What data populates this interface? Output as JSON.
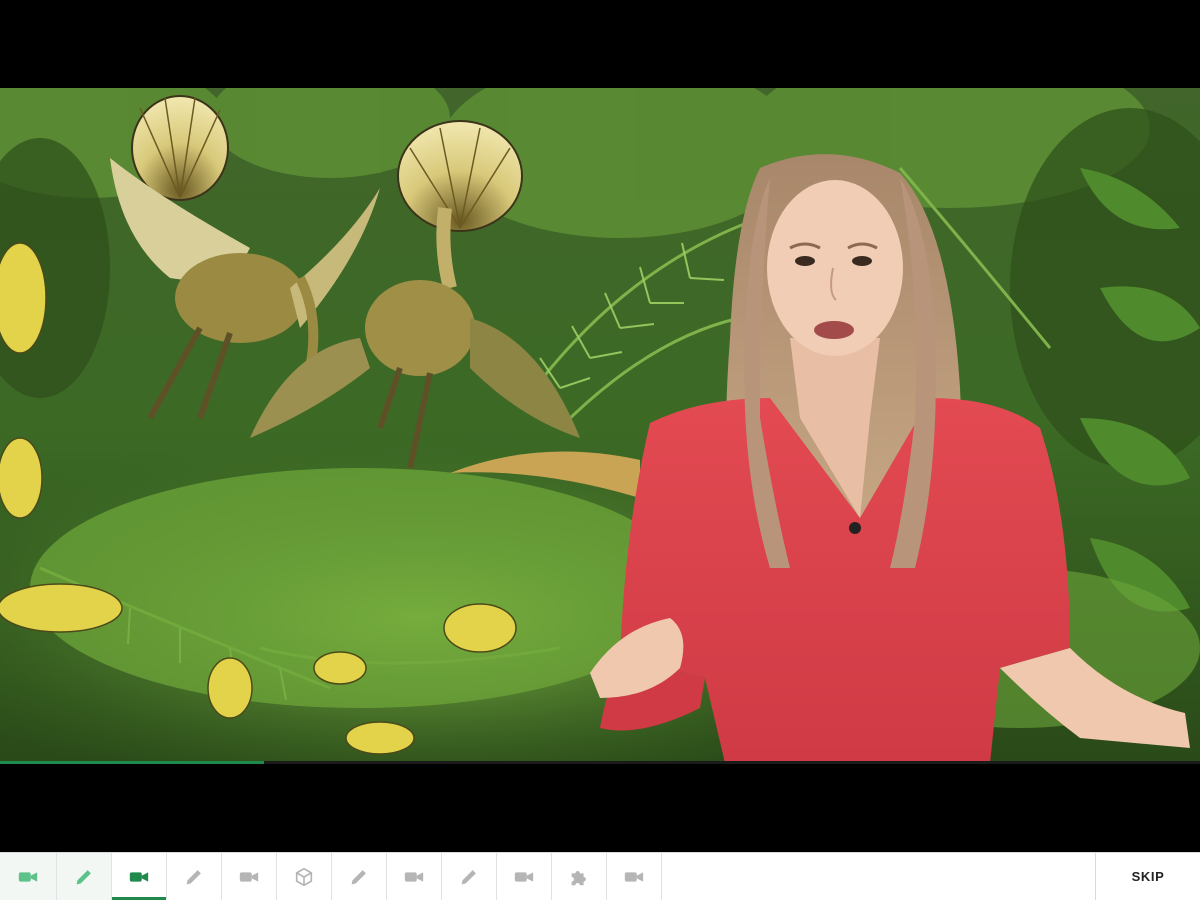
{
  "player": {
    "video_progress_fraction": 0.22
  },
  "lesson_steps": [
    {
      "type": "video",
      "icon": "video-camera-icon",
      "state": "completed"
    },
    {
      "type": "exercise",
      "icon": "pencil-icon",
      "state": "completed"
    },
    {
      "type": "video",
      "icon": "video-camera-icon",
      "state": "current"
    },
    {
      "type": "exercise",
      "icon": "pencil-icon",
      "state": "upcoming"
    },
    {
      "type": "video",
      "icon": "video-camera-icon",
      "state": "upcoming"
    },
    {
      "type": "3d-model",
      "icon": "cube-icon",
      "state": "upcoming"
    },
    {
      "type": "exercise",
      "icon": "pencil-icon",
      "state": "upcoming"
    },
    {
      "type": "video",
      "icon": "video-camera-icon",
      "state": "upcoming"
    },
    {
      "type": "exercise",
      "icon": "pencil-icon",
      "state": "upcoming"
    },
    {
      "type": "video",
      "icon": "video-camera-icon",
      "state": "upcoming"
    },
    {
      "type": "puzzle",
      "icon": "puzzle-piece-icon",
      "state": "upcoming"
    },
    {
      "type": "video",
      "icon": "video-camera-icon",
      "state": "upcoming"
    }
  ],
  "toolbar": {
    "skip_label": "SKIP"
  },
  "colors": {
    "accent": "#1f8a4c",
    "completed_icon": "#5cc28a",
    "upcoming_icon": "#b5b5b5"
  }
}
